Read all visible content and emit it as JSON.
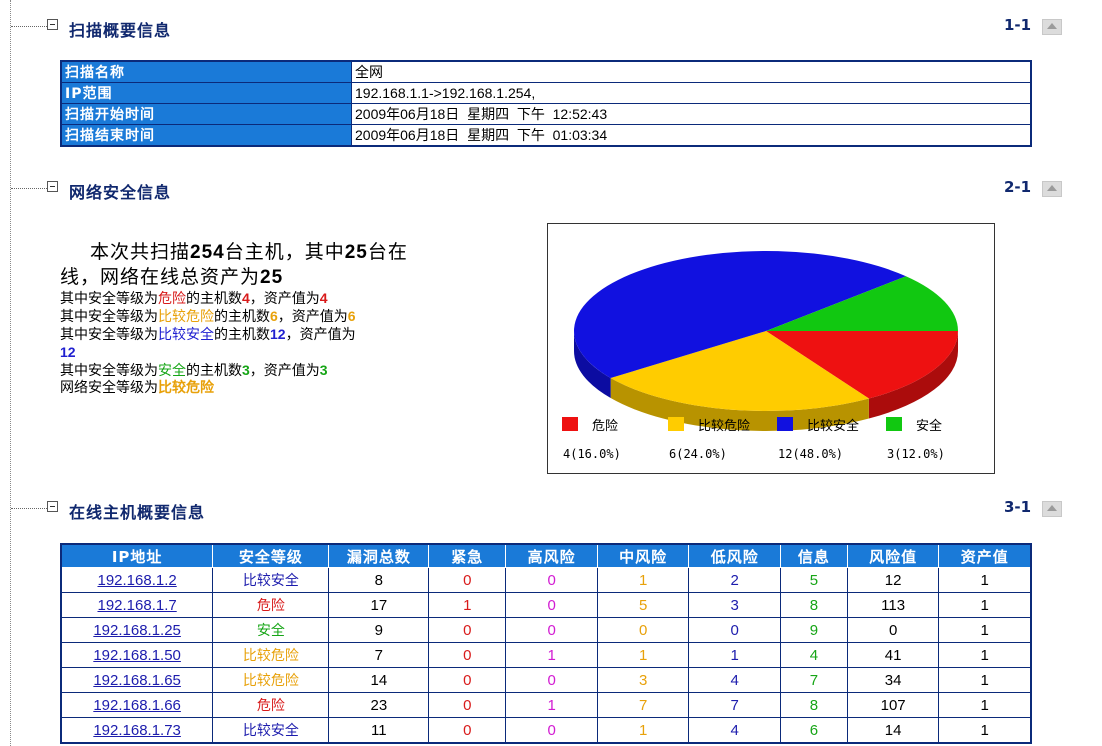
{
  "sections": [
    {
      "title": "扫描概要信息",
      "num": "1-1"
    },
    {
      "title": "网络安全信息",
      "num": "2-1"
    },
    {
      "title": "在线主机概要信息",
      "num": "3-1"
    }
  ],
  "scan_info": [
    {
      "label": "扫描名称",
      "value": "全网"
    },
    {
      "label": "IP范围",
      "value": "192.168.1.1->192.168.1.254,"
    },
    {
      "label": "扫描开始时间",
      "value": "2009年06月18日  星期四  下午  12:52:43"
    },
    {
      "label": "扫描结束时间",
      "value": "2009年06月18日  星期四  下午  01:03:34"
    }
  ],
  "summary": {
    "line1_a": "本次共扫描",
    "line1_total": "254",
    "line1_b": "台主机，其中",
    "line1_online": "25",
    "line1_c": "台在",
    "line2_a": "线，网络在线总资产为",
    "line2_assets": "25",
    "rows": [
      {
        "pre": "其中安全等级为",
        "level": "危险",
        "mid": "的主机数",
        "count": "4",
        "sep": "，资产值为",
        "asset": "4",
        "color": "red"
      },
      {
        "pre": "其中安全等级为",
        "level": "比较危险",
        "mid": "的主机数",
        "count": "6",
        "sep": "，资产值为",
        "asset": "6",
        "color": "orange"
      },
      {
        "pre": "其中安全等级为",
        "level": "比较安全",
        "mid": "的主机数",
        "count": "12",
        "sep": "，资产值为",
        "asset": "12",
        "color": "blue"
      },
      {
        "pre": "其中安全等级为",
        "level": "安全",
        "mid": "的主机数",
        "count": "3",
        "sep": "，资产值为",
        "asset": "3",
        "color": "green"
      }
    ],
    "final_pre": "网络安全等级为",
    "final_level": "比较危险"
  },
  "chart_data": {
    "type": "pie",
    "categories": [
      "危险",
      "比较危险",
      "比较安全",
      "安全"
    ],
    "values": [
      4,
      6,
      12,
      3
    ],
    "labels": [
      "4(16.0%)",
      "6(24.0%)",
      "12(48.0%)",
      "3(12.0%)"
    ],
    "colors": [
      "#ee1111",
      "#ffcc00",
      "#1111e0",
      "#11c811"
    ],
    "legend": "bottom"
  },
  "hosts": {
    "columns": [
      "IP地址",
      "安全等级",
      "漏洞总数",
      "紧急",
      "高风险",
      "中风险",
      "低风险",
      "信息",
      "风险值",
      "资产值"
    ],
    "rows": [
      {
        "ip": "192.168.1.2",
        "level": "比较安全",
        "level_color": "#1c1cad",
        "total": "8",
        "urgent": "0",
        "high": "0",
        "mid": "1",
        "low": "2",
        "info": "5",
        "risk": "12",
        "asset": "1"
      },
      {
        "ip": "192.168.1.7",
        "level": "危险",
        "level_color": "#d81a1a",
        "total": "17",
        "urgent": "1",
        "high": "0",
        "mid": "5",
        "low": "3",
        "info": "8",
        "risk": "113",
        "asset": "1"
      },
      {
        "ip": "192.168.1.25",
        "level": "安全",
        "level_color": "#16a516",
        "total": "9",
        "urgent": "0",
        "high": "0",
        "mid": "0",
        "low": "0",
        "info": "9",
        "risk": "0",
        "asset": "1"
      },
      {
        "ip": "192.168.1.50",
        "level": "比较危险",
        "level_color": "#e8a10a",
        "total": "7",
        "urgent": "0",
        "high": "1",
        "mid": "1",
        "low": "1",
        "info": "4",
        "risk": "41",
        "asset": "1"
      },
      {
        "ip": "192.168.1.65",
        "level": "比较危险",
        "level_color": "#e8a10a",
        "total": "14",
        "urgent": "0",
        "high": "0",
        "mid": "3",
        "low": "4",
        "info": "7",
        "risk": "34",
        "asset": "1"
      },
      {
        "ip": "192.168.1.66",
        "level": "危险",
        "level_color": "#d81a1a",
        "total": "23",
        "urgent": "0",
        "high": "1",
        "mid": "7",
        "low": "7",
        "info": "8",
        "risk": "107",
        "asset": "1"
      },
      {
        "ip": "192.168.1.73",
        "level": "比较安全",
        "level_color": "#1c1cad",
        "total": "11",
        "urgent": "0",
        "high": "0",
        "mid": "1",
        "low": "4",
        "info": "6",
        "risk": "14",
        "asset": "1"
      }
    ],
    "cell_colors": {
      "urgent": "#d81a1a",
      "high": "#d21ad2",
      "mid": "#e8a10a",
      "low": "#1c1cad",
      "info": "#16a516"
    }
  }
}
